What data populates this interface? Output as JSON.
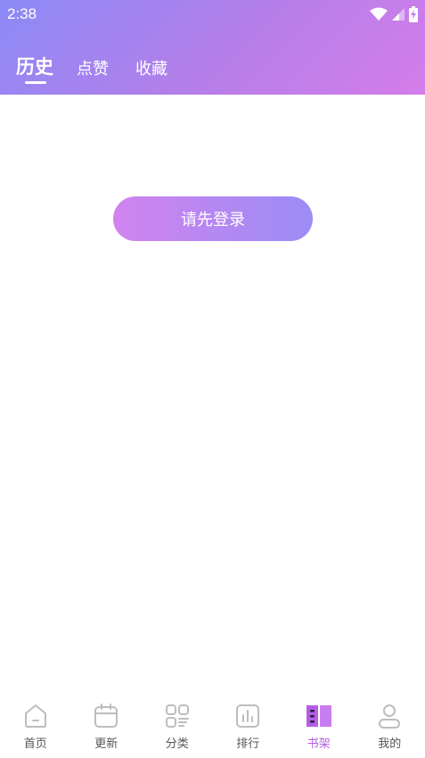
{
  "status_bar": {
    "time": "2:38",
    "icons": [
      "wifi-icon",
      "cell-signal-icon",
      "battery-charging-icon"
    ]
  },
  "tabs": [
    {
      "label": "历史",
      "active": true
    },
    {
      "label": "点赞",
      "active": false
    },
    {
      "label": "收藏",
      "active": false
    }
  ],
  "main": {
    "login_label": "请先登录"
  },
  "bottom_nav": [
    {
      "label": "首页",
      "icon": "home-icon",
      "active": false
    },
    {
      "label": "更新",
      "icon": "calendar-icon",
      "active": false
    },
    {
      "label": "分类",
      "icon": "category-grid-icon",
      "active": false
    },
    {
      "label": "排行",
      "icon": "ranking-chart-icon",
      "active": false
    },
    {
      "label": "书架",
      "icon": "bookshelf-icon",
      "active": true
    },
    {
      "label": "我的",
      "icon": "profile-icon",
      "active": false
    }
  ],
  "colors": {
    "header_start": "#8c8af6",
    "header_end": "#d47dea",
    "button_start": "#d183ef",
    "button_end": "#9b8cf5",
    "active_nav": "#b35ee6",
    "inactive_nav": "#555555"
  }
}
